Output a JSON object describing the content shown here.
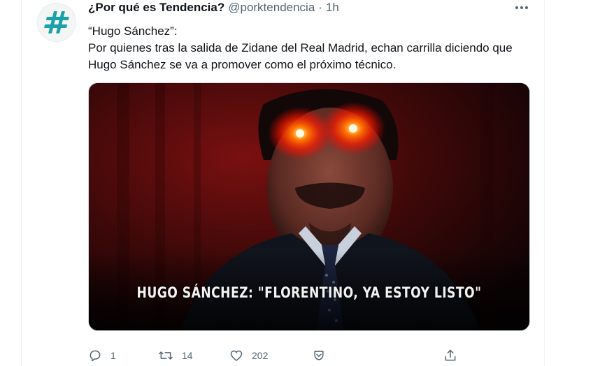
{
  "tweet": {
    "display_name": "¿Por qué es Tendencia?",
    "handle": "@porktendencia",
    "separator": "·",
    "time": "1h",
    "text_line1": "“Hugo Sánchez”:",
    "text_line2": "Por quienes tras la salida de Zidane del Real Madrid, echan carrilla diciendo que Hugo Sánchez se va a promover como el próximo técnico.",
    "media_caption": "HUGO SÁNCHEZ: \"FLORENTINO, YA ESTOY LISTO\""
  },
  "actions": {
    "reply_count": "1",
    "retweet_count": "14",
    "like_count": "202"
  },
  "colors": {
    "avatar_mark": "#1da1a8",
    "secondary_text": "#536471",
    "laser_eyes": "#ff2a00"
  },
  "icons": [
    "hashtag-icon",
    "more-dots-icon",
    "reply-icon",
    "retweet-icon",
    "like-icon",
    "tip-icon",
    "share-icon"
  ]
}
